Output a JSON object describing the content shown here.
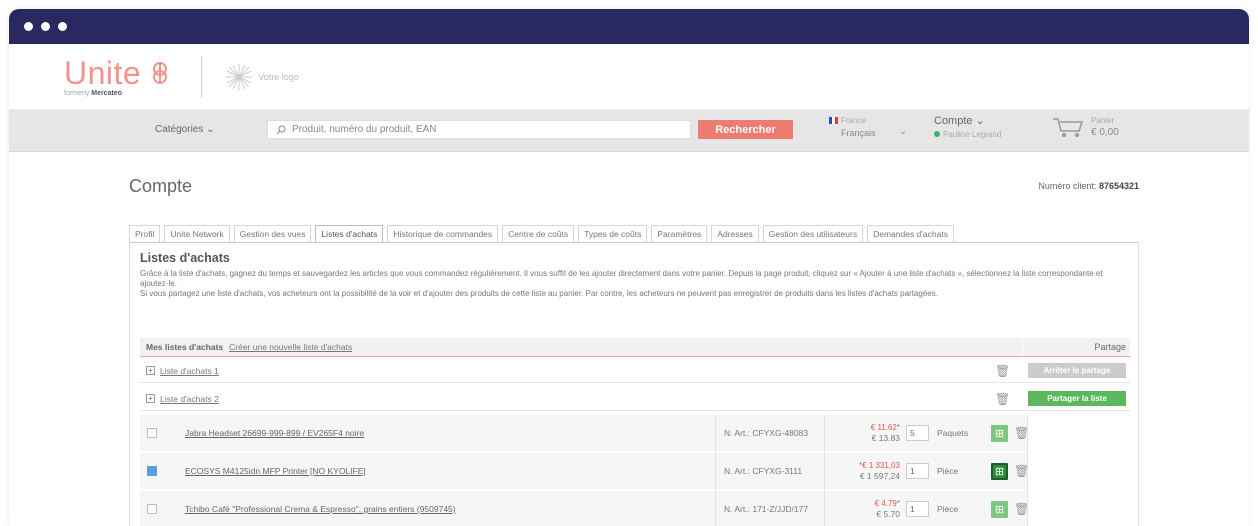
{
  "brand": {
    "name": "Unite",
    "subtitle_prefix": "formerly",
    "subtitle_name": "Mercateo",
    "logo_placeholder": "Votre logo"
  },
  "nav": {
    "categories_label": "Catégories",
    "search_placeholder": "Produit, numéro du produit, EAN",
    "search_button": "Rechercher",
    "country": "France",
    "language": "Français",
    "account_label": "Compte",
    "account_user": "Pauline Legrand",
    "cart_label": "Panier",
    "cart_amount": "€ 0,00"
  },
  "page": {
    "title": "Compte",
    "client_label": "Numéro client:",
    "client_number": "87654321"
  },
  "tabs": [
    "Profil",
    "Unite Network",
    "Gestion des vues",
    "Listes d'achats",
    "Historique de commandes",
    "Centre de coûts",
    "Types de coûts",
    "Paramètres",
    "Adresses",
    "Gestion des utilisateurs",
    "Demandes d'achats"
  ],
  "section": {
    "title": "Listes d'achats",
    "intro1": "Grâce à la liste d'achats, gagnez du temps et sauvegardez les articles que vous commandez régulièrement. Il vous suffit de les ajouter directement dans votre panier. Depuis la page produit, cliquez sur « Ajouter à une liste d'achats », sélectionnez la liste correspondante et ajoutez-le.",
    "intro2": "Si vous partagez une liste d'achats, vos acheteurs ont la possibilité de la voir et d'ajouter des produits de cette liste au panier. Par contre, les acheteurs ne peuvent pas enregistrer de produits dans les listes d'achats partagées."
  },
  "lists_header": {
    "mine": "Mes listes d'achats",
    "create": "Créer une nouvelle liste d'achats",
    "share": "Partage"
  },
  "lists": [
    {
      "name": "Liste d'achats 1",
      "share_button": "Arrêter le partage"
    },
    {
      "name": "Liste d'achats 2",
      "share_button": "Partager la liste"
    }
  ],
  "products": [
    {
      "name": "Jabra Headset 26699-999-899 / EV265F4 noire",
      "art": "N. Art.: CFYXG-48083",
      "price_red": "€ 11.62*",
      "price": "€ 13.83",
      "qty": "5",
      "unit": "Paquets",
      "checked": false
    },
    {
      "name": "ECOSYS M4125idn MFP Printer [NO KYOLIFE]",
      "art": "N. Art.: CFYXG-3111",
      "price_red": "*€ 1 331,03",
      "price": "€ 1 597,24",
      "qty": "1",
      "unit": "Pièce",
      "checked": true
    },
    {
      "name": "Tchibo Café \"Professional Crema & Espresso\", grains entiers (9509745)",
      "art": "N. Art.: 171-Z/JJD/177",
      "price_red": "€ 4.79*",
      "price": "€ 5.70",
      "qty": "1",
      "unit": "Pièce",
      "checked": false
    }
  ]
}
